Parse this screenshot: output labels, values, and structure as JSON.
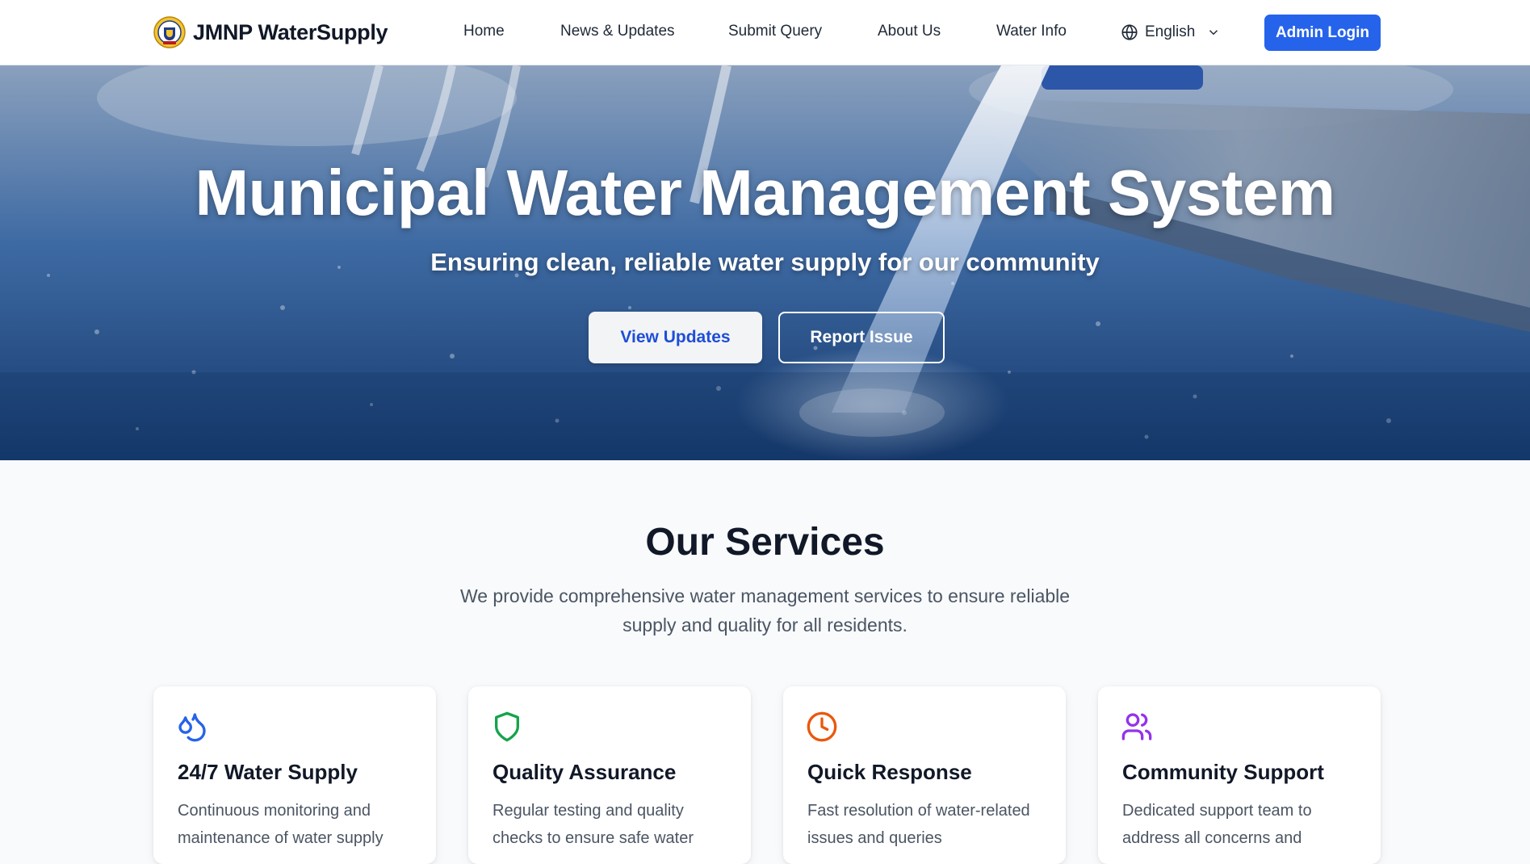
{
  "brand": {
    "name": "JMNP WaterSupply",
    "logo_icon": "municipal-emblem-icon"
  },
  "nav": {
    "links": [
      {
        "label": "Home"
      },
      {
        "label": "News & Updates"
      },
      {
        "label": "Submit Query"
      },
      {
        "label": "About Us"
      },
      {
        "label": "Water Info"
      }
    ],
    "language": {
      "selected": "English",
      "icon": "globe-icon"
    },
    "admin_login": "Admin Login"
  },
  "hero": {
    "title": "Municipal Water Management System",
    "subtitle": "Ensuring clean, reliable water supply for our community",
    "primary_button": "View Updates",
    "secondary_button": "Report Issue"
  },
  "services": {
    "title": "Our Services",
    "description": "We provide comprehensive water management services to ensure reliable supply and quality for all residents.",
    "cards": [
      {
        "icon": "water-droplets-icon",
        "icon_color": "#2563eb",
        "title": "24/7 Water Supply",
        "text": "Continuous monitoring and maintenance of water supply"
      },
      {
        "icon": "shield-icon",
        "icon_color": "#16a34a",
        "title": "Quality Assurance",
        "text": "Regular testing and quality checks to ensure safe water"
      },
      {
        "icon": "clock-icon",
        "icon_color": "#ea580c",
        "title": "Quick Response",
        "text": "Fast resolution of water-related issues and queries"
      },
      {
        "icon": "users-icon",
        "icon_color": "#9333ea",
        "title": "Community Support",
        "text": "Dedicated support team to address all concerns and"
      }
    ]
  },
  "colors": {
    "accent": "#2563eb",
    "heading": "#111827",
    "body_text": "#4b5563",
    "page_bg": "#f8fafc"
  }
}
